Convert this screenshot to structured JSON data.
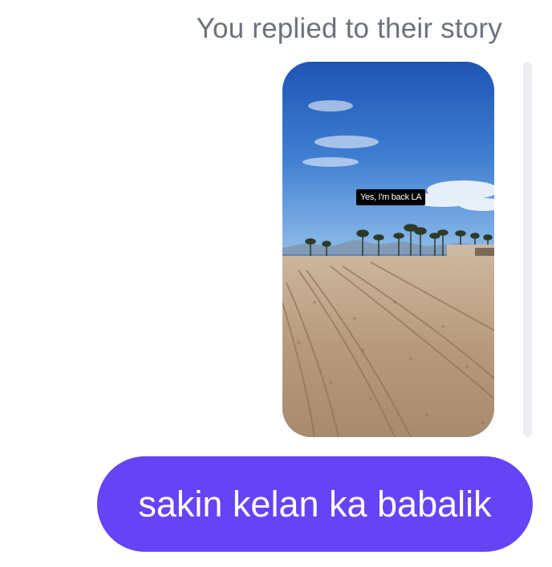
{
  "thread": {
    "caption": "You replied to their story",
    "story": {
      "sticker_text": "Yes, I'm back LA",
      "scene": "beach-with-palm-trees-photo"
    },
    "reply_message": "sakin kelan ka babalik"
  },
  "colors": {
    "caption_gray": "#6d7279",
    "bubble_purple": "#6444f5",
    "bubble_text": "#ffffff",
    "reply_bar": "#eceef1"
  }
}
